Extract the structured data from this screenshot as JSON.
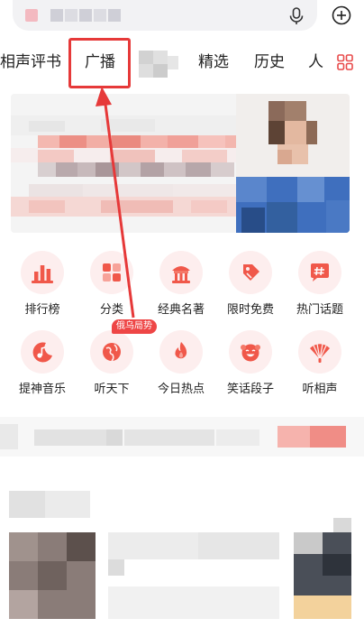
{
  "tabs": [
    {
      "label": "相声评书"
    },
    {
      "label": "广播"
    },
    {
      "label": "精选"
    },
    {
      "label": "历史"
    },
    {
      "label": "人"
    }
  ],
  "categories": [
    {
      "label": "排行榜",
      "icon": "ranking-bars-icon"
    },
    {
      "label": "分类",
      "icon": "category-grid-icon"
    },
    {
      "label": "经典名著",
      "icon": "classic-building-icon"
    },
    {
      "label": "限时免费",
      "icon": "price-tag-icon"
    },
    {
      "label": "热门话题",
      "icon": "hashtag-bubble-icon"
    },
    {
      "label": "提神音乐",
      "icon": "music-moon-icon"
    },
    {
      "label": "听天下",
      "icon": "globe-icon"
    },
    {
      "label": "今日热点",
      "icon": "flame-icon"
    },
    {
      "label": "笑话段子",
      "icon": "laughing-face-icon"
    },
    {
      "label": "听相声",
      "icon": "folding-fan-icon"
    }
  ],
  "badge": {
    "label": "俄乌局势"
  },
  "colors": {
    "accent": "#e63939",
    "icon_red": "#f0584a",
    "icon_bg": "#fdeeee"
  }
}
